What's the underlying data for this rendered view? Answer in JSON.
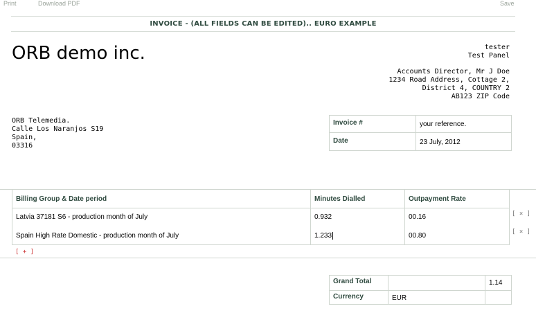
{
  "toolbar": {
    "print_label": "Print",
    "download_label": "Download PDF",
    "save_label": "Save"
  },
  "title": "INVOICE - (ALL FIELDS CAN BE EDITED).. EURO EXAMPLE",
  "company_name": "ORB demo inc.",
  "sender": {
    "line1": "tester",
    "line2": "Test Panel"
  },
  "recipient_address": [
    "Accounts Director, Mr J Doe",
    "1234 Road Address, Cottage 2,",
    "District 4, COUNTRY 2",
    "AB123 ZIP Code"
  ],
  "from_address": [
    "ORB Telemedia.",
    "Calle Los Naranjos S19",
    "Spain,",
    "03316"
  ],
  "invoice_meta": {
    "number_label": "Invoice #",
    "number_value": "your reference.",
    "date_label": "Date",
    "date_value": "23 July, 2012"
  },
  "items_table": {
    "headers": [
      "Billing Group & Date period",
      "Minutes Dialled",
      "Outpayment Rate"
    ],
    "rows": [
      {
        "description": "Latvia 37181 S6  - production month of July",
        "minutes": "0.932",
        "rate": "00.16",
        "remove": "[ × ]"
      },
      {
        "description": "Spain High Rate Domestic - production month of July",
        "minutes": "1.233",
        "rate": "00.80",
        "remove": "[ × ]"
      }
    ],
    "add_label": "[ + ]"
  },
  "totals": {
    "grand_total_label": "Grand Total",
    "grand_total_value": "1.14",
    "currency_label": "Currency",
    "currency_value": "EUR"
  }
}
